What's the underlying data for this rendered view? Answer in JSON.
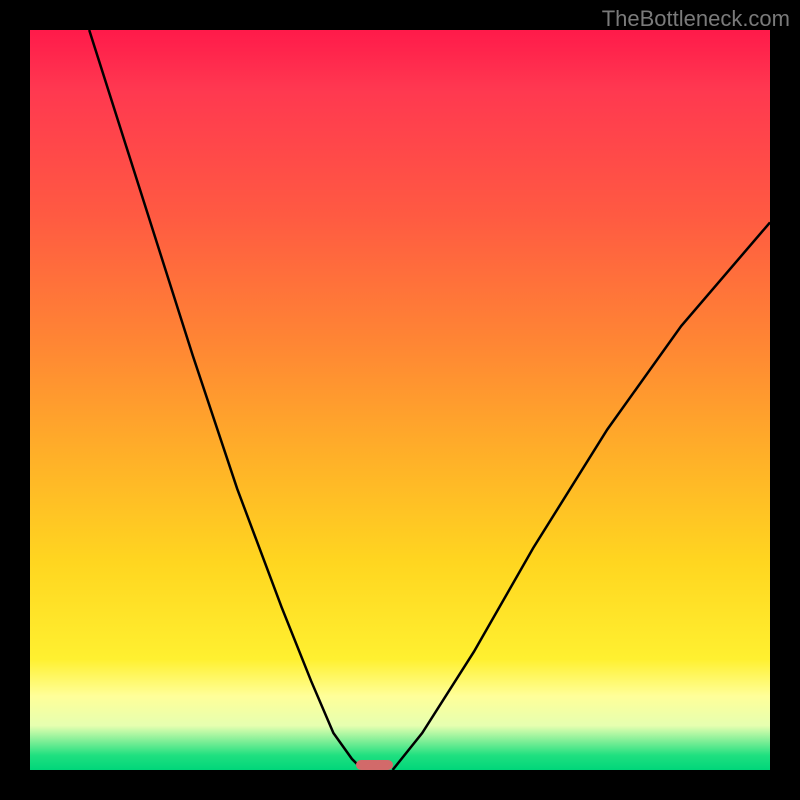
{
  "watermark": "TheBottleneck.com",
  "chart_data": {
    "type": "line",
    "title": "",
    "xlabel": "",
    "ylabel": "",
    "xlim": [
      0,
      1
    ],
    "ylim": [
      0,
      1
    ],
    "series": [
      {
        "name": "left-branch",
        "x": [
          0.08,
          0.15,
          0.22,
          0.28,
          0.34,
          0.38,
          0.41,
          0.435,
          0.45
        ],
        "y": [
          1.0,
          0.78,
          0.56,
          0.38,
          0.22,
          0.12,
          0.05,
          0.015,
          0.0
        ]
      },
      {
        "name": "right-branch",
        "x": [
          0.49,
          0.53,
          0.6,
          0.68,
          0.78,
          0.88,
          1.0
        ],
        "y": [
          0.0,
          0.05,
          0.16,
          0.3,
          0.46,
          0.6,
          0.74
        ]
      }
    ],
    "marker": {
      "x_center": 0.465,
      "width": 0.05,
      "color": "#d26a6a"
    },
    "gradient_stops": [
      {
        "pos": 0.0,
        "color": "#ff1a4a"
      },
      {
        "pos": 0.25,
        "color": "#ff5a42"
      },
      {
        "pos": 0.58,
        "color": "#ffb128"
      },
      {
        "pos": 0.85,
        "color": "#fff030"
      },
      {
        "pos": 0.94,
        "color": "#e6ffb0"
      },
      {
        "pos": 1.0,
        "color": "#00d67a"
      }
    ]
  }
}
